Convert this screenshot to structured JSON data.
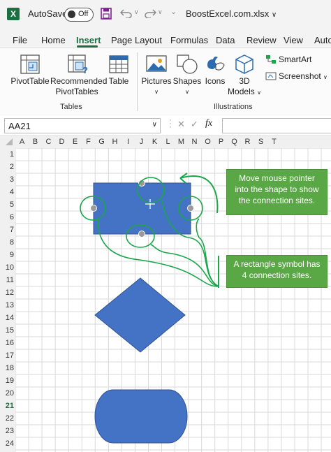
{
  "titlebar": {
    "autosave_label": "AutoSave",
    "toggle_state": "Off",
    "filename": "BoostExcel.com.xlsx",
    "filename_chevron": "∨"
  },
  "tabs": [
    "File",
    "Home",
    "Insert",
    "Page Layout",
    "Formulas",
    "Data",
    "Review",
    "View",
    "Auto"
  ],
  "active_tab": "Insert",
  "ribbon": {
    "pivot_table": "PivotTable",
    "recommended_line1": "Recommended",
    "recommended_line2": "PivotTables",
    "table": "Table",
    "tables_group": "Tables",
    "pictures": "Pictures",
    "shapes": "Shapes",
    "icons": "Icons",
    "models_line1": "3D",
    "models_line2": "Models",
    "smartart": "SmartArt",
    "screenshot": "Screenshot",
    "illustrations_group": "Illustrations"
  },
  "formula_bar": {
    "name_box": "AA21",
    "cancel": "✕",
    "enter": "✓",
    "fx": "fx",
    "formula": ""
  },
  "columns": [
    "A",
    "B",
    "C",
    "D",
    "E",
    "F",
    "G",
    "H",
    "I",
    "J",
    "K",
    "L",
    "M",
    "N",
    "O",
    "P",
    "Q",
    "R",
    "S",
    "T"
  ],
  "rows": [
    "1",
    "2",
    "3",
    "4",
    "5",
    "6",
    "7",
    "8",
    "9",
    "10",
    "11",
    "12",
    "13",
    "14",
    "15",
    "16",
    "17",
    "18",
    "19",
    "20",
    "21",
    "22",
    "23",
    "24"
  ],
  "callouts": {
    "top": [
      "Move mouse pointer",
      "into the shape to show",
      "the connection sites."
    ],
    "bottom": [
      "A rectangle symbol has",
      "4 connection sites."
    ]
  },
  "colors": {
    "shape_fill": "#4472c4",
    "callout_fill": "#5aa845",
    "connector_green": "#1aa64a",
    "brand": "#1d6f42"
  }
}
